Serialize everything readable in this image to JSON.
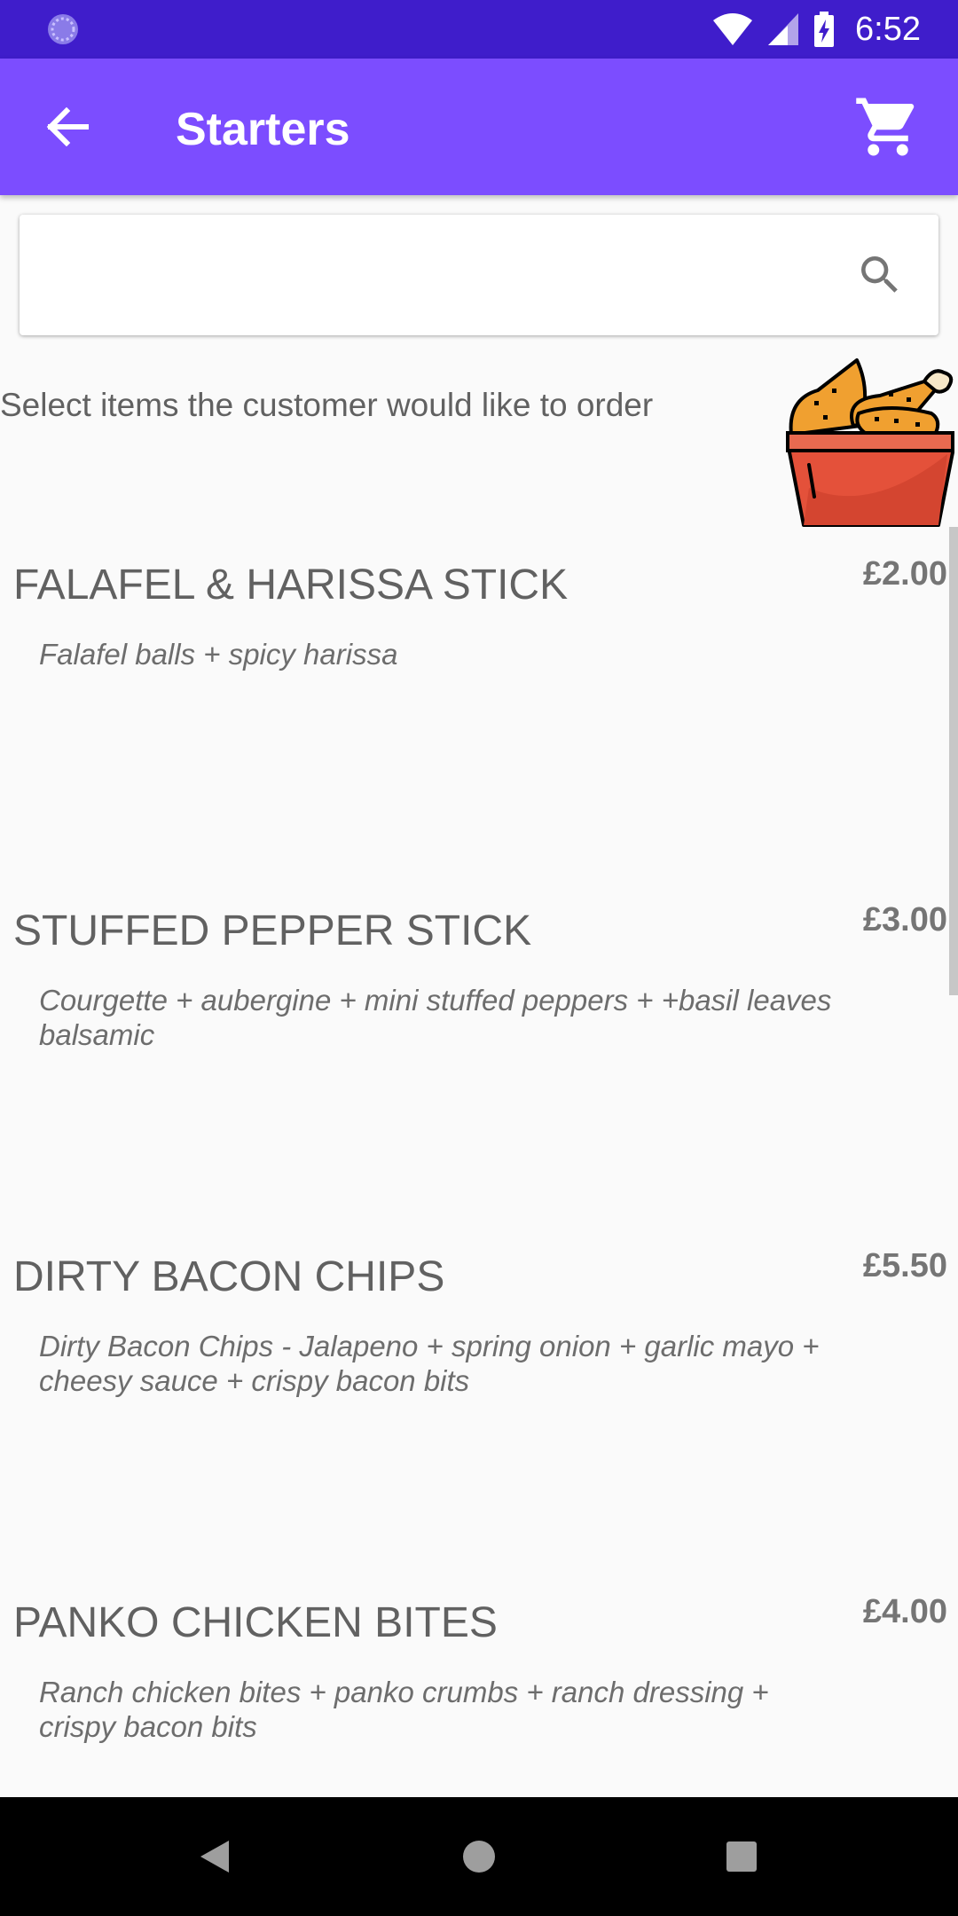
{
  "status_bar": {
    "time": "6:52",
    "icons": [
      "loading-icon",
      "wifi-icon",
      "signal-icon",
      "battery-charging-icon"
    ]
  },
  "app_bar": {
    "title": "Starters",
    "back_icon": "arrow-back-icon",
    "cart_icon": "cart-icon"
  },
  "search": {
    "value": "",
    "placeholder": "",
    "icon": "search-icon"
  },
  "instruction": "Select items the customer would like to order",
  "colors": {
    "status_bar": "#3f1dcb",
    "app_bar": "#7c4dff",
    "background": "#fafafa"
  },
  "items": [
    {
      "name": "FALAFEL & HARISSA STICK",
      "price": "£2.00",
      "description": "Falafel balls + spicy harissa"
    },
    {
      "name": "STUFFED PEPPER STICK",
      "price": "£3.00",
      "description": "Courgette + aubergine + mini stuffed peppers + +basil leaves balsamic"
    },
    {
      "name": "DIRTY BACON CHIPS",
      "price": "£5.50",
      "description": "Dirty Bacon Chips - Jalapeno + spring onion + garlic mayo + cheesy sauce + crispy bacon bits"
    },
    {
      "name": "PANKO CHICKEN BITES",
      "price": "£4.00",
      "description": "Ranch chicken bites + panko crumbs + ranch dressing + crispy bacon bits"
    }
  ]
}
